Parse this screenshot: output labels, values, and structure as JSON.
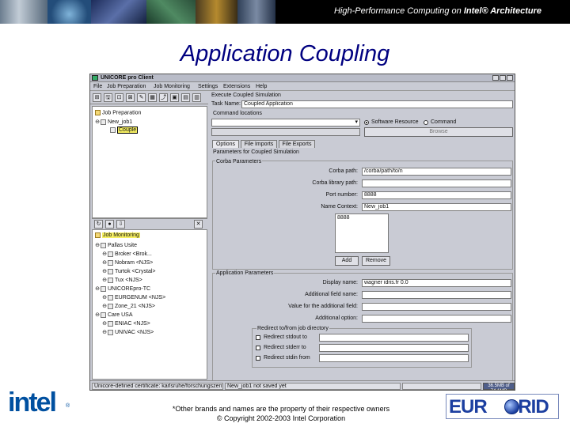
{
  "slide": {
    "header": "High-Performance Computing on",
    "header_bold": "Intel® Architecture",
    "title": "Application Coupling",
    "footer_line1": "*Other brands and names are the property of their respective owners",
    "footer_line2": "© Copyright 2002-2003 Intel Corporation",
    "intel_logo": "intel",
    "intel_reg": "®",
    "eurogrid_logo_left": "EUR",
    "eurogrid_logo_right": "GRID"
  },
  "window": {
    "title": "UNICORE pro Client",
    "menu": [
      "File",
      "Job Preparation",
      "Job Monitoring",
      "Settings",
      "Extensions",
      "Help"
    ],
    "toolbar_left": [
      "⊞",
      "🖫",
      "⊡",
      "⊠",
      "✎",
      "▦",
      "⤴",
      "▣",
      "▤",
      "▥"
    ],
    "tree_preparation": {
      "root": "Job Preparation",
      "job": "New_job1",
      "child": "Couple"
    },
    "tree_monitoring": {
      "root": "Job Monitoring",
      "items": [
        {
          "label": "Pallas Usite",
          "level": 1
        },
        {
          "label": "Broker <Brok...",
          "level": 2
        },
        {
          "label": "Nobram <NJS>",
          "level": 2
        },
        {
          "label": "Turtok <Crystal>",
          "level": 2
        },
        {
          "label": "Tux <NJS>",
          "level": 2
        },
        {
          "label": "UNICOREpro-TC",
          "level": 1
        },
        {
          "label": "EURGENUM <NJS>",
          "level": 2
        },
        {
          "label": "Zone_21 <NJS>",
          "level": 2
        },
        {
          "label": "Care USA",
          "level": 1
        },
        {
          "label": "ENIAC <NJS>",
          "level": 2
        },
        {
          "label": "UNIVAC <NJS>",
          "level": 2
        }
      ]
    },
    "form": {
      "execute_label": "Execute Coupled Simulation",
      "task_name_label": "Task Name:",
      "task_name_value": "Coupled Application",
      "command_locations_label": "Command locations",
      "software_resource_label": "Software Resource",
      "command_label": "Command",
      "browse_label": "Browse",
      "tabs": [
        "Options",
        "File Imports",
        "File Exports"
      ],
      "params_label": "Parameters for Coupled Simulation",
      "corba_params_label": "Corba Parameters",
      "corba_path_label": "Corba path:",
      "corba_path_value": "/corba/path/to/n",
      "corba_lib_label": "Corba library path:",
      "port_label": "Port number:",
      "port_value": "8888",
      "name_context_label": "Name Context:",
      "name_context_value": "New_job1",
      "port_list": [
        "8888"
      ],
      "add_label": "Add",
      "remove_label": "Remove",
      "app_params_label": "Application Parameters",
      "display_name_label": "Display name:",
      "display_name_value": "wagner idris.fr 0.0",
      "add_field_label": "Additional field name:",
      "add_value_label": "Value for the additional field:",
      "add_option_label": "Additional option:",
      "redirect_label": "Redirect to/from job directory",
      "redirect_stdout": "Redirect stdout to",
      "redirect_stderr": "Redirect stderr to",
      "redirect_stdin": "Redirect stdin from"
    },
    "status": {
      "left": "Unicore-defined certificate: karlsruhe/forschungszentrum(s",
      "middle": "New_job1 not saved yet",
      "memory": "36.5MB of 74.1MB"
    }
  },
  "colors": {
    "title_blue": "#000080",
    "intel_blue": "#0050a0",
    "eurogrid_blue": "#1c3fa0",
    "selection_yellow": "#f6ef62"
  }
}
